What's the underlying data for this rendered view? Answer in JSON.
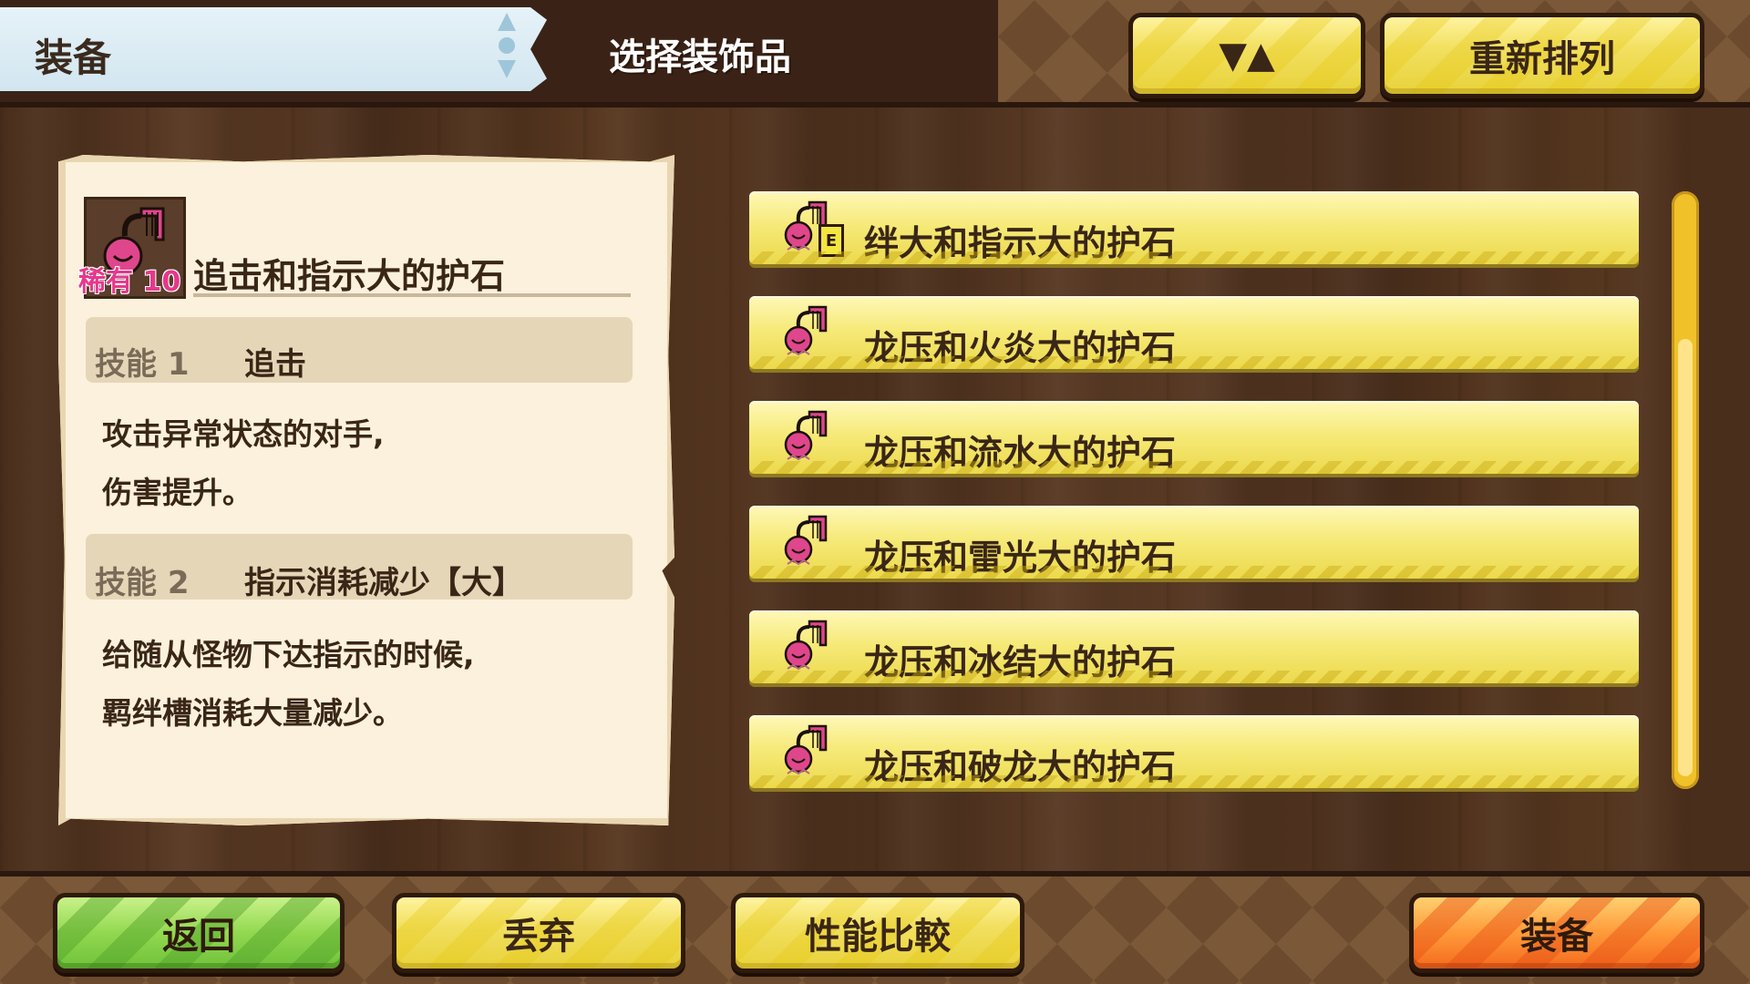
{
  "header": {
    "title": "装备",
    "subtitle": "选择装饰品",
    "sort_label": "▼▲",
    "rearrange_label": "重新排列"
  },
  "detail": {
    "rarity": "稀有 10",
    "item_name": "追击和指示大的护石",
    "skills": [
      {
        "label": "技能 1",
        "name": "追击",
        "description": [
          "攻击异常状态的对手,",
          "伤害提升。"
        ]
      },
      {
        "label": "技能 2",
        "name": "指示消耗减少【大】",
        "description": [
          "给随从怪物下达指示的时候,",
          "羁绊槽消耗大量减少。"
        ]
      }
    ]
  },
  "list": {
    "equipped_badge": "E",
    "items": [
      {
        "label": "绊大和指示大的护石",
        "equipped": true
      },
      {
        "label": "龙压和火炎大的护石",
        "equipped": false
      },
      {
        "label": "龙压和流水大的护石",
        "equipped": false
      },
      {
        "label": "龙压和雷光大的护石",
        "equipped": false
      },
      {
        "label": "龙压和冰结大的护石",
        "equipped": false
      },
      {
        "label": "龙压和破龙大的护石",
        "equipped": false
      }
    ]
  },
  "footer": {
    "back_label": "返回",
    "discard_label": "丢弃",
    "compare_label": "性能比較",
    "equip_label": "装备"
  },
  "colors": {
    "rarity": "#e6388c",
    "charm": "#e0468c",
    "wood": "#4a2e1c"
  }
}
